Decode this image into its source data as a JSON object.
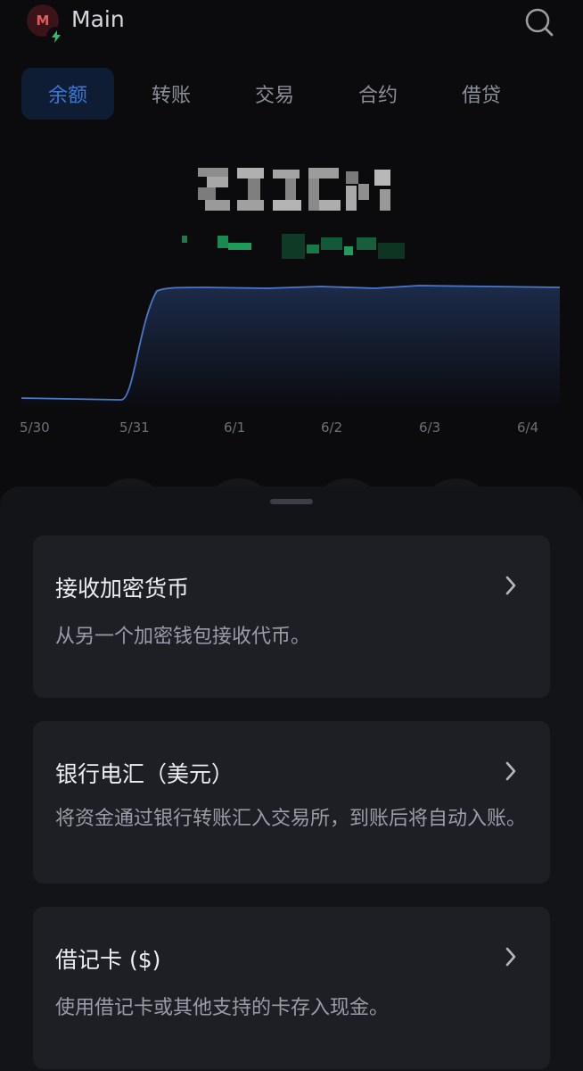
{
  "header": {
    "avatar_letter": "M",
    "account_name": "Main",
    "avatar_color": "#e25b5b",
    "badge_color": "#2dbd6e"
  },
  "tabs": [
    {
      "label": "余额",
      "active": true
    },
    {
      "label": "转账",
      "active": false
    },
    {
      "label": "交易",
      "active": false
    },
    {
      "label": "合约",
      "active": false
    },
    {
      "label": "借贷",
      "active": false
    }
  ],
  "balance": {
    "redacted": true,
    "change_color": "#1f9a5a"
  },
  "chart": {
    "x_ticks": [
      "5/30",
      "5/31",
      "6/1",
      "6/2",
      "6/3",
      "6/4"
    ],
    "line_color": "#4a78c9"
  },
  "cards": [
    {
      "title": "接收加密货币",
      "desc": "从另一个加密钱包接收代币。"
    },
    {
      "title": "银行电汇（美元）",
      "desc": "将资金通过银行转账汇入交易所，到账后将自动入账。"
    },
    {
      "title": "借记卡 ($)",
      "desc": "使用借记卡或其他支持的卡存入现金。"
    }
  ],
  "colors": {
    "background": "#0b0b0e",
    "accent": "#3b78d8",
    "card_bg": "#1e1f25"
  }
}
